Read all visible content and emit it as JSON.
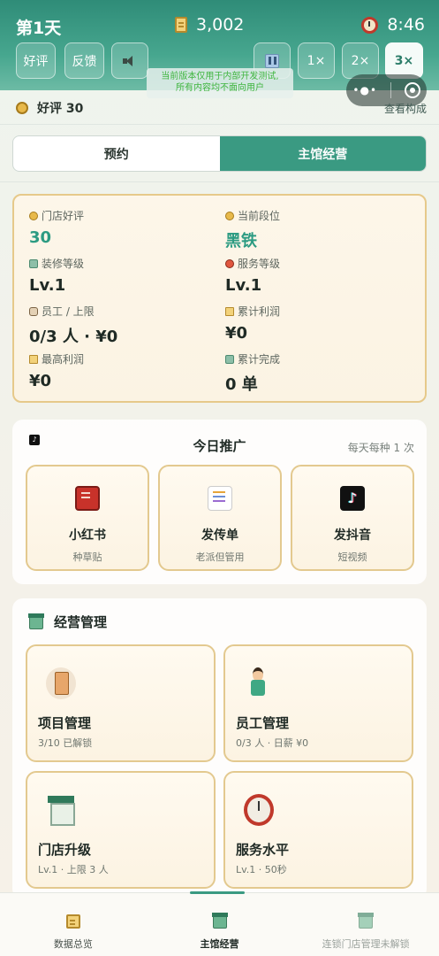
{
  "header": {
    "day": "第1天",
    "money": "3,002",
    "time": "8:46",
    "buttons": {
      "good_review": "好评",
      "feedback": "反馈",
      "speed_1": "1×",
      "speed_2": "2×",
      "speed_3": "3×"
    },
    "icons": {
      "money": "note-icon",
      "time": "alarm-clock-icon",
      "mute": "speaker-mute-icon",
      "pause": "pause-icon"
    },
    "active_speed": "3×",
    "dev_notice_line1": "当前版本仅用于内部开发测试,",
    "dev_notice_line2": "所有内容均不面向用户",
    "capsule": {
      "more": "•●•",
      "close": "target-icon"
    },
    "colors": {
      "primary": "#3a9a82",
      "notice": "#3fb53f"
    }
  },
  "rating": {
    "label": "好评 30",
    "link": "查看构成"
  },
  "tabs": [
    {
      "label": "预约",
      "active": false
    },
    {
      "label": "主馆经营",
      "active": true
    }
  ],
  "stats": {
    "store_rating": {
      "label": "门店好评",
      "value": "30"
    },
    "current_tier": {
      "label": "当前段位",
      "value": "黑铁"
    },
    "decor_level": {
      "label": "装修等级",
      "value": "Lv.1"
    },
    "service_level": {
      "label": "服务等级",
      "value": "Lv.1"
    },
    "staff_limit": {
      "label": "员工 / 上限",
      "value": "0/3 人 · ¥0"
    },
    "total_profit": {
      "label": "累计利润",
      "value": "¥0"
    },
    "max_profit": {
      "label": "最高利润",
      "value": "¥0"
    },
    "total_done": {
      "label": "累计完成",
      "value": "0 单"
    }
  },
  "promo": {
    "title": "今日推广",
    "hint": "每天每种 1 次",
    "items": [
      {
        "label": "小红书",
        "sub": "种草贴",
        "icon": "red-book-icon"
      },
      {
        "label": "发传单",
        "sub": "老派但管用",
        "icon": "flyer-icon"
      },
      {
        "label": "发抖音",
        "sub": "短视频",
        "icon": "tiktok-icon"
      }
    ]
  },
  "manage": {
    "title": "经营管理",
    "items": [
      {
        "label": "项目管理",
        "sub": "3/10 已解锁",
        "icon": "project-scroll-icon"
      },
      {
        "label": "员工管理",
        "sub": "0/3 人 · 日薪 ¥0",
        "icon": "staff-icon"
      },
      {
        "label": "门店升级",
        "sub": "Lv.1 · 上限 3 人",
        "icon": "store-icon"
      },
      {
        "label": "服务水平",
        "sub": "Lv.1 · 50秒",
        "icon": "stopwatch-icon"
      }
    ]
  },
  "bottom_nav": [
    {
      "label": "数据总览",
      "active": false,
      "icon": "data-overview-icon"
    },
    {
      "label": "主馆经营",
      "active": true,
      "icon": "main-store-icon"
    },
    {
      "label": "连锁门店管理未解锁",
      "active": false,
      "icon": "chain-store-icon"
    }
  ]
}
